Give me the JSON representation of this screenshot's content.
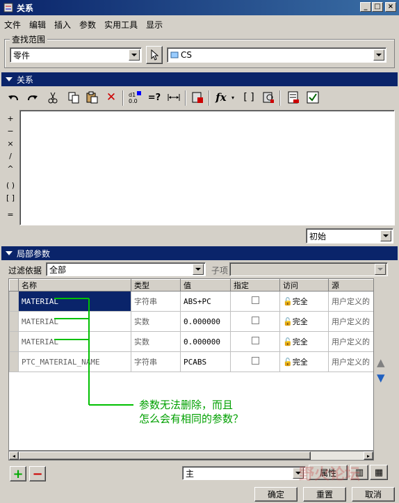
{
  "window": {
    "title": "关系",
    "buttons": [
      "_",
      "□",
      "×"
    ]
  },
  "menu": [
    "文件",
    "编辑",
    "插入",
    "参数",
    "实用工具",
    "显示"
  ],
  "scope": {
    "legend": "查找范围",
    "type_value": "零件",
    "object_value": "CS"
  },
  "relations": {
    "section_title": "关系",
    "toolbar_icons": [
      "undo-icon",
      "redo-icon",
      "cut-icon",
      "copy-icon",
      "paste-icon",
      "delete-icon",
      "units-icon",
      "verify-icon",
      "measure-icon",
      "sort-icon",
      "function-icon",
      "brackets-icon",
      "evaluate-icon",
      "list-icon",
      "check-icon"
    ],
    "operators": [
      "+",
      "−",
      "×",
      "/",
      "^",
      "( )",
      "[ ]",
      "="
    ],
    "mode_value": "初始"
  },
  "local_params": {
    "section_title": "局部参数",
    "filter_label": "过滤依据",
    "filter_value": "全部",
    "sub_label": "子项",
    "columns": [
      "名称",
      "类型",
      "值",
      "指定",
      "访问",
      "源"
    ],
    "rows": [
      {
        "name": "MATERIAL",
        "type": "字符串",
        "value": "ABS+PC",
        "access": "完全",
        "source": "用户定义的"
      },
      {
        "name": "MATERIAL",
        "type": "实数",
        "value": "0.000000",
        "access": "完全",
        "source": "用户定义的"
      },
      {
        "name": "MATERIAL",
        "type": "实数",
        "value": "0.000000",
        "access": "完全",
        "source": "用户定义的"
      },
      {
        "name": "PTC_MATERIAL_NAME",
        "type": "字符串",
        "value": "PCABS",
        "access": "完全",
        "source": "用户定义的"
      }
    ],
    "annotation_line1": "参数无法删除，而且",
    "annotation_line2": "怎么会有相同的参数？",
    "main_value": "主",
    "properties_label": "属性"
  },
  "footer": {
    "ok": "确定",
    "reset": "重置",
    "cancel": "取消"
  },
  "watermark": "野火论坛",
  "colors": {
    "title": "#0a246a",
    "selection": "#0a246a",
    "annotation": "#00a000"
  }
}
